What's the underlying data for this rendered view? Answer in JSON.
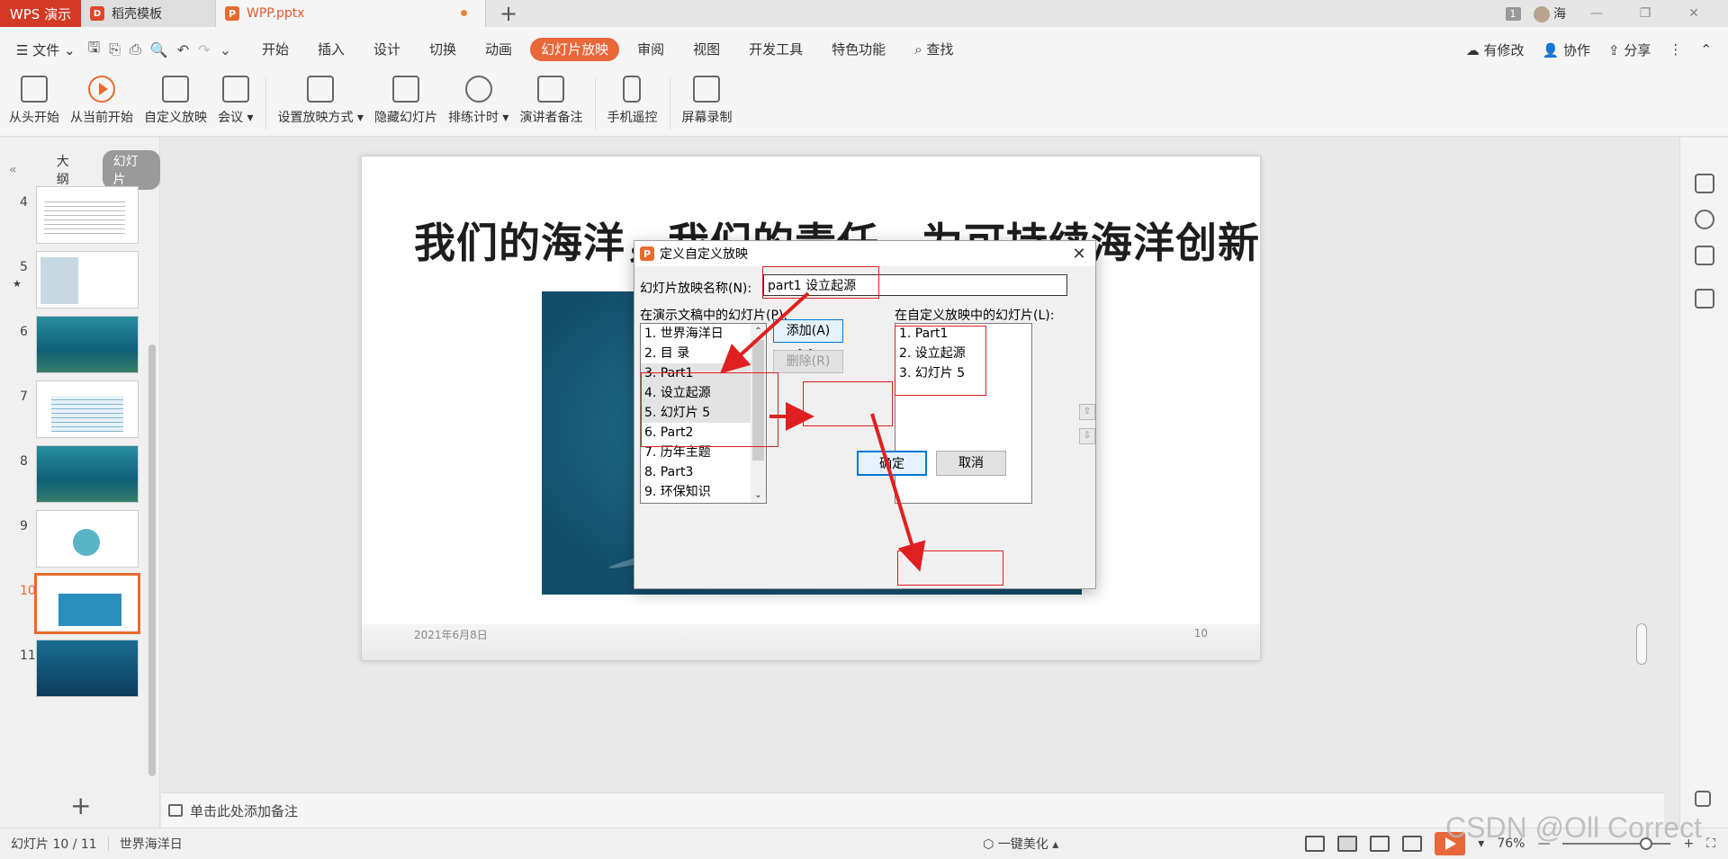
{
  "titlebar": {
    "app_tab": "WPS 演示",
    "tabs": [
      {
        "label": "稻壳模板"
      },
      {
        "label": "WPP.pptx"
      }
    ],
    "new_tab": "+",
    "window_num": "1",
    "user": "海"
  },
  "menubar": {
    "file": "文件",
    "items": [
      "开始",
      "插入",
      "设计",
      "切换",
      "动画",
      "幻灯片放映",
      "审阅",
      "视图",
      "开发工具",
      "特色功能"
    ],
    "active_item": "幻灯片放映",
    "search": "查找",
    "right": [
      "有修改",
      "协作",
      "分享"
    ]
  },
  "ribbon": {
    "buttons": [
      {
        "label": "从头开始",
        "icon": "screen-icon"
      },
      {
        "label": "从当前开始",
        "icon": "play-icon"
      },
      {
        "label": "自定义放映",
        "icon": "custom-show-icon"
      },
      {
        "label": "会议",
        "icon": "meeting-icon"
      },
      {
        "label": "设置放映方式",
        "icon": "settings-icon"
      },
      {
        "label": "隐藏幻灯片",
        "icon": "hide-icon"
      },
      {
        "label": "排练计时",
        "icon": "timer-icon"
      },
      {
        "label": "演讲者备注",
        "icon": "notes-icon"
      },
      {
        "label": "手机遥控",
        "icon": "phone-icon"
      },
      {
        "label": "屏幕录制",
        "icon": "record-icon"
      }
    ]
  },
  "leftpanel": {
    "tabs": [
      "大纲",
      "幻灯片"
    ],
    "active_tab": "幻灯片",
    "thumbnails": [
      {
        "num": "4"
      },
      {
        "num": "5",
        "star": "★"
      },
      {
        "num": "6"
      },
      {
        "num": "7"
      },
      {
        "num": "8"
      },
      {
        "num": "9"
      },
      {
        "num": "10"
      },
      {
        "num": "11"
      }
    ],
    "active_slide": "10"
  },
  "slide": {
    "title": "我们的海洋，我们的责任，为可持续海洋创新",
    "date": "2021年6月8日",
    "number": "10"
  },
  "notes": {
    "placeholder": "单击此处添加备注"
  },
  "statusbar": {
    "slide_indicator": "幻灯片 10 / 11",
    "theme": "世界海洋日",
    "beautify": "一键美化",
    "zoom": "76%"
  },
  "watermark": "CSDN @Oll Correct",
  "dialog": {
    "title": "定义自定义放映",
    "name_label": "幻灯片放映名称(N):",
    "name_value": "part1 设立起源",
    "left_label": "在演示文稿中的幻灯片(P):",
    "right_label": "在自定义放映中的幻灯片(L):",
    "left_items": [
      "1. 世界海洋日",
      "2. 目 录",
      "3. Part1",
      "4. 设立起源",
      "5. 幻灯片 5",
      "6. Part2",
      "7. 历年主题",
      "8. Part3",
      "9. 环保知识"
    ],
    "right_items": [
      "1. Part1",
      "2. 设立起源",
      "3. 幻灯片 5"
    ],
    "add_button": "添加(A) >>",
    "delete_button": "删除(R)",
    "ok_button": "确定",
    "cancel_button": "取消"
  },
  "colors": {
    "accent": "#e8683a",
    "annotation": "#e02020"
  }
}
